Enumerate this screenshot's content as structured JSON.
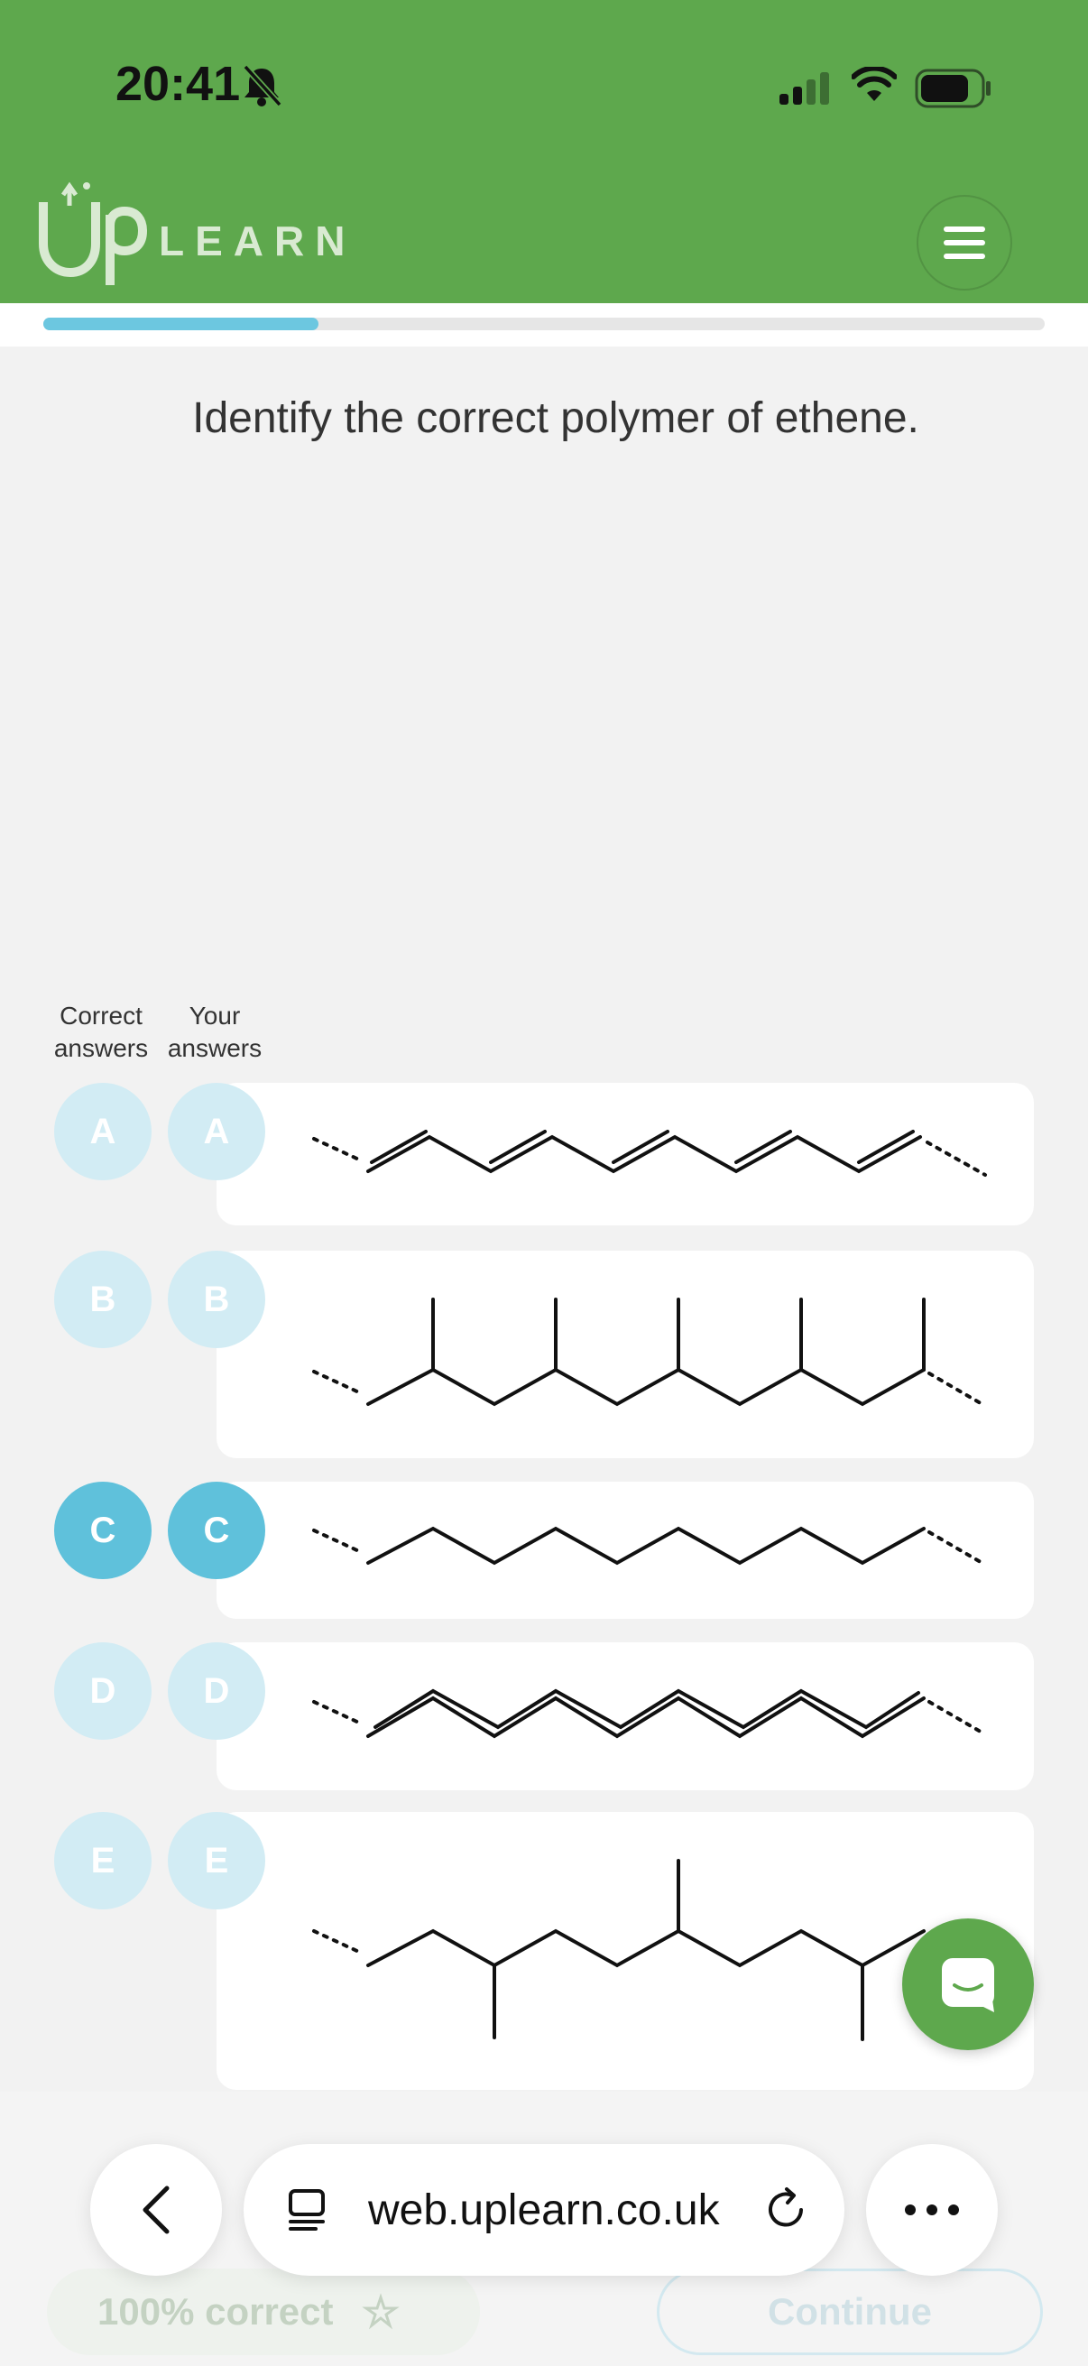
{
  "status_bar": {
    "time": "20:41"
  },
  "header": {
    "logo_text": "LEARN",
    "logo_mark": "Up"
  },
  "progress": {
    "fraction": 0.275
  },
  "question": {
    "text": "Identify the correct polymer of ethene."
  },
  "columns": {
    "correct_line1": "Correct",
    "correct_line2": "answers",
    "yours_line1": "Your",
    "yours_line2": "answers"
  },
  "options": [
    {
      "letter": "A",
      "correct": false,
      "selected": false,
      "structure": "conjugated-polyene"
    },
    {
      "letter": "B",
      "correct": false,
      "selected": false,
      "structure": "polypropene-chain"
    },
    {
      "letter": "C",
      "correct": true,
      "selected": true,
      "structure": "polyethene-chain"
    },
    {
      "letter": "D",
      "correct": false,
      "selected": false,
      "structure": "alternating-double-bond-chain"
    },
    {
      "letter": "E",
      "correct": false,
      "selected": false,
      "structure": "branched-chain"
    }
  ],
  "footer": {
    "score_label": "100% correct",
    "continue_label": "Continue"
  },
  "browser": {
    "url": "web.uplearn.co.uk"
  },
  "colors": {
    "brand_green": "#5ea84d",
    "accent_blue": "#5fc1db",
    "light_blue": "#d2ecf4"
  },
  "icons": [
    "bell-slash-icon",
    "signal-icon",
    "wifi-icon",
    "battery-icon",
    "menu-icon",
    "chat-icon",
    "back-chevron-icon",
    "tabs-icon",
    "reload-icon",
    "more-icon",
    "sparkle-star-icon"
  ]
}
